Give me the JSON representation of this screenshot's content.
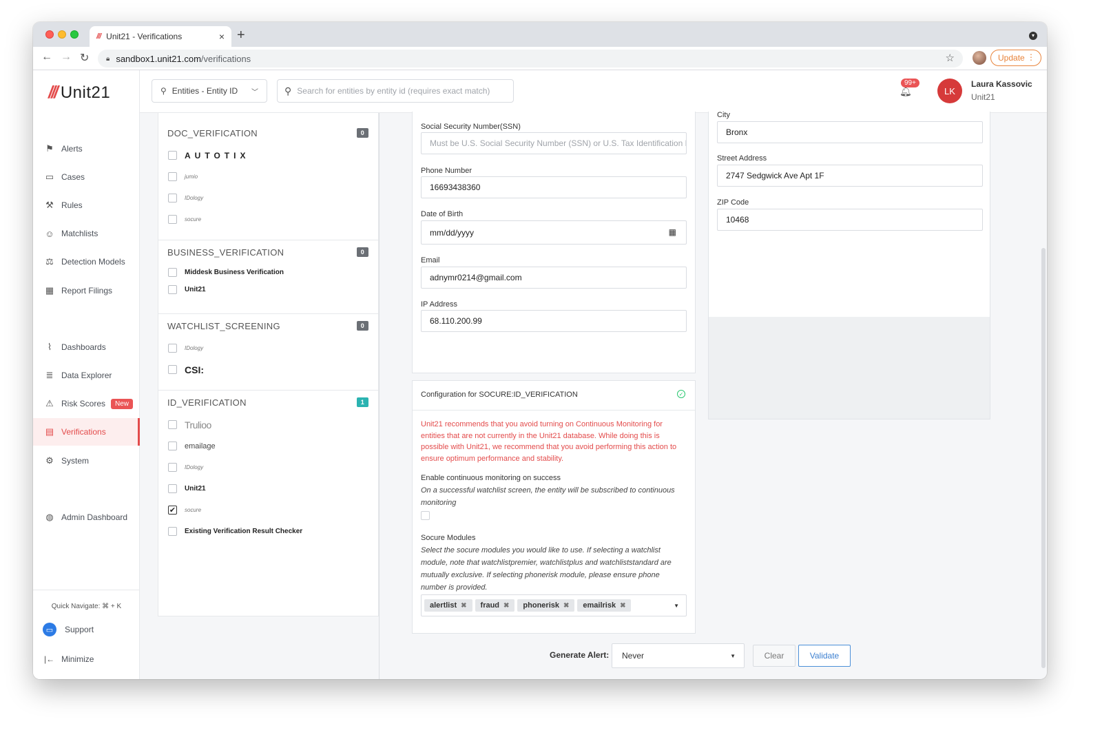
{
  "browser": {
    "tab_title": "Unit21 - Verifications",
    "tab_favicon": "///",
    "url_host": "sandbox1.unit21.com",
    "url_path": "/verifications",
    "update_label": "Update"
  },
  "app": {
    "logo_mark": "///",
    "logo_text": "Unit21",
    "nav": [
      {
        "label": "Alerts",
        "icon": "flag-icon",
        "glyph": "⚑"
      },
      {
        "label": "Cases",
        "icon": "briefcase-icon",
        "glyph": "▭"
      },
      {
        "label": "Rules",
        "icon": "gavel-icon",
        "glyph": "⚒"
      },
      {
        "label": "Matchlists",
        "icon": "user-x-icon",
        "glyph": "☺"
      },
      {
        "label": "Detection Models",
        "icon": "scale-icon",
        "glyph": "⚖"
      },
      {
        "label": "Report Filings",
        "icon": "building-icon",
        "glyph": "▦"
      },
      {
        "label": "Dashboards",
        "icon": "chart-icon",
        "glyph": "⌇"
      },
      {
        "label": "Data Explorer",
        "icon": "explore-icon",
        "glyph": "≣"
      },
      {
        "label": "Risk Scores",
        "icon": "warning-icon",
        "glyph": "⚠",
        "badge": "New"
      },
      {
        "label": "Verifications",
        "icon": "id-card-icon",
        "glyph": "▤"
      },
      {
        "label": "System",
        "icon": "gear-icon",
        "glyph": "⚙"
      },
      {
        "label": "Admin Dashboard",
        "icon": "globe-icon",
        "glyph": "◍"
      }
    ],
    "quick_navigate": "Quick Navigate: ⌘ + K",
    "support_label": "Support",
    "minimize_label": "Minimize"
  },
  "topbar": {
    "entity_select": "Entities - Entity ID",
    "search_placeholder": "Search for entities by entity id (requires exact match)",
    "notifications_badge": "99+",
    "user_initials": "LK",
    "user_name": "Laura Kassovic",
    "user_org": "Unit21"
  },
  "vendors": {
    "doc": {
      "title": "DOC_VERIFICATION",
      "count": "0",
      "items": [
        {
          "label": "AUTOTIX",
          "checked": false
        },
        {
          "label": "jumio",
          "checked": false
        },
        {
          "label": "IDology",
          "checked": false
        },
        {
          "label": "socure",
          "checked": false
        }
      ]
    },
    "business": {
      "title": "BUSINESS_VERIFICATION",
      "count": "0",
      "items": [
        {
          "label": "Middesk Business Verification",
          "checked": false
        },
        {
          "label": "Unit21",
          "checked": false
        }
      ]
    },
    "watchlist": {
      "title": "WATCHLIST_SCREENING",
      "count": "0",
      "items": [
        {
          "label": "IDology",
          "checked": false
        },
        {
          "label": "CSI:",
          "checked": false
        }
      ]
    },
    "id": {
      "title": "ID_VERIFICATION",
      "count": "1",
      "items": [
        {
          "label": "Trulioo",
          "checked": false
        },
        {
          "label": "emailage",
          "checked": false
        },
        {
          "label": "IDology",
          "checked": false
        },
        {
          "label": "Unit21",
          "checked": false
        },
        {
          "label": "socure",
          "checked": true
        },
        {
          "label": "Existing Verification Result Checker",
          "checked": false
        }
      ]
    }
  },
  "form": {
    "ssn_label": "Social Security Number(SSN)",
    "ssn_placeholder": "Must be U.S. Social Security Number (SSN) or U.S. Tax Identification N",
    "phone_label": "Phone Number",
    "phone_value": "16693438360",
    "dob_label": "Date of Birth",
    "dob_value": "mm/dd/yyyy",
    "email_label": "Email",
    "email_value": "adnymr0214@gmail.com",
    "ip_label": "IP Address",
    "ip_value": "68.110.200.99",
    "city_label": "City",
    "city_value": "Bronx",
    "street_label": "Street Address",
    "street_value": "2747 Sedgwick Ave Apt 1F",
    "zip_label": "ZIP Code",
    "zip_value": "10468"
  },
  "config": {
    "title": "Configuration for SOCURE:ID_VERIFICATION",
    "warning": "Unit21 recommends that you avoid turning on Continuous Monitoring for entities that are not currently in the Unit21 database. While doing this is possible with Unit21, we recommend that you avoid performing this action to ensure optimum performance and stability.",
    "monitor_heading": "Enable continuous monitoring on success",
    "monitor_help": "On a successful watchlist screen, the entity will be subscribed to continuous monitoring",
    "monitor_enabled": false,
    "modules_heading": "Socure Modules",
    "modules_help": "Select the socure modules you would like to use. If selecting a watchlist module, note that watchlistpremier, watchlistplus and watchliststandard are mutually exclusive. If selecting phonerisk module, please ensure phone number is provided.",
    "modules": [
      "alertlist",
      "fraud",
      "phonerisk",
      "emailrisk"
    ]
  },
  "footer": {
    "generate_label": "Generate Alert:",
    "generate_value": "Never",
    "clear_label": "Clear",
    "validate_label": "Validate"
  },
  "colors": {
    "brand": "#e34b4b",
    "primary": "#3b7fd0",
    "success": "#28c76f"
  }
}
